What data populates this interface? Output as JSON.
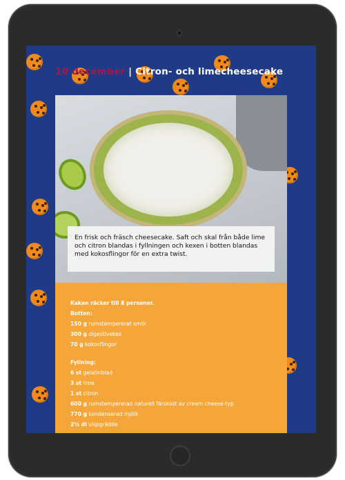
{
  "header": {
    "date": "10 december",
    "separator": "|",
    "title": "Citron- och limecheesecake"
  },
  "caption": "En frisk och fräsch cheesecake. Saft och skal från både lime och citron blandas i fyllningen och kexen i botten blandas med kokosflingor för en extra twist.",
  "recipe": {
    "servings": "Kakan räcker till 8 personer.",
    "bottom_heading": "Botten:",
    "bottom_items": [
      {
        "qty": "150 g",
        "name": "rumstempererat smör"
      },
      {
        "qty": "300 g",
        "name": "digestivekex"
      },
      {
        "qty": "70 g",
        "name": "kokosflingor"
      }
    ],
    "filling_heading": "Fyllning:",
    "filling_items": [
      {
        "qty": "6 st",
        "name": "gelatinblad"
      },
      {
        "qty": "3 st",
        "name": "lime"
      },
      {
        "qty": "1 st",
        "name": "citron"
      },
      {
        "qty": "600 g",
        "name": "rumstempererad naturell färskost av cream cheese-typ"
      },
      {
        "qty": "770 g",
        "name": "kondenserad mjölk"
      },
      {
        "qty": "2½ dl",
        "name": "vispgrädde"
      }
    ]
  },
  "colors": {
    "background": "#1f3a86",
    "date": "#a3194b",
    "recipe_card": "#f5a63a",
    "cookie": "#f08a1c"
  },
  "icons": [
    "cookie-icon",
    "home-button",
    "camera"
  ]
}
